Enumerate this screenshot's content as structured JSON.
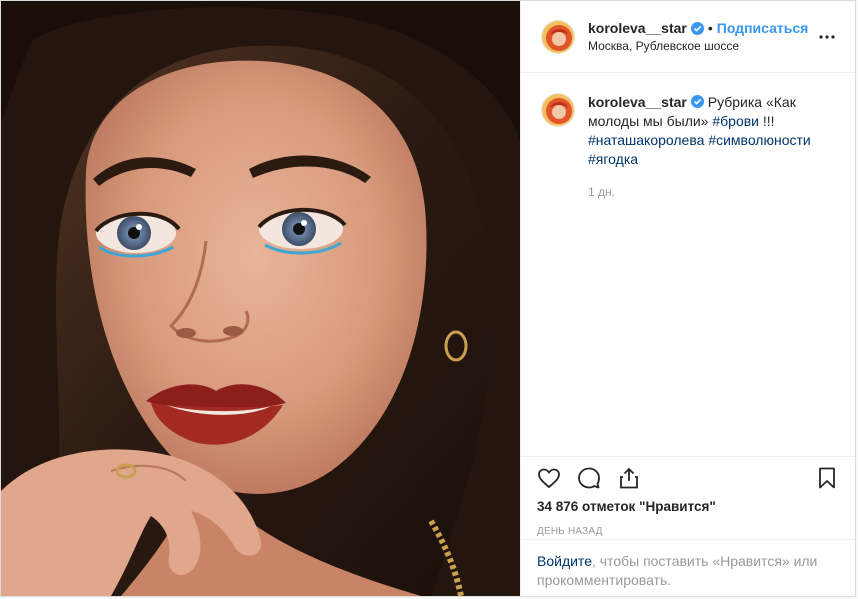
{
  "header": {
    "username": "koroleva__star",
    "dot": "•",
    "follow_label": "Подписаться",
    "location": "Москва, Рублевское шоссе"
  },
  "caption": {
    "username": "koroleva__star",
    "text": "Рубрика «Как молоды мы были»",
    "tags": [
      "#брови",
      "#наташакоролева",
      "#символюности",
      "#ягодка"
    ],
    "suffix": "!!!",
    "time": "1 дн."
  },
  "actions": {
    "likes": "34 876 отметок \"Нравится\"",
    "date": "день назад"
  },
  "login_prompt": {
    "link": "Войдите",
    "rest": ", чтобы поставить «Нравится» или прокомментировать."
  },
  "colors": {
    "accent": "#3897f0",
    "hashtag": "#003569",
    "muted": "#999999"
  },
  "icons": [
    "verified-badge-icon",
    "more-options-icon",
    "heart-icon",
    "comment-icon",
    "share-icon",
    "bookmark-icon"
  ]
}
